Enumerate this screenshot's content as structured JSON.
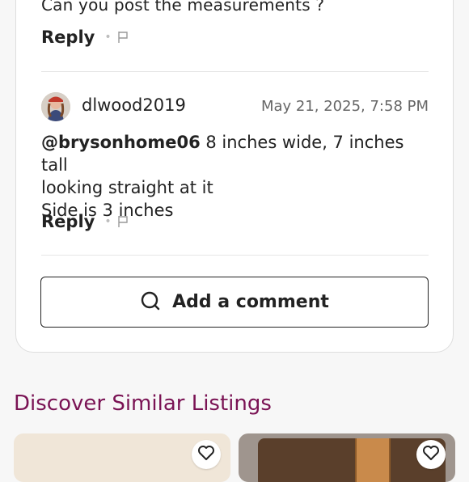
{
  "previous_comment": {
    "text": "Can you post the measurements ?",
    "reply_label": "Reply"
  },
  "comment": {
    "username": "dlwood2019",
    "timestamp": "May 21, 2025, 7:58 PM",
    "mention": "@brysonhome06",
    "body_line1": " 8 inches wide, 7 inches tall",
    "body_line2": "looking straight at it",
    "body_line3": "Side is 3 inches",
    "reply_label": "Reply"
  },
  "add_comment": {
    "label": "Add a comment",
    "icon": "search-icon"
  },
  "similar": {
    "title": "Discover Similar Listings",
    "listings": [
      {
        "icon": "heart-icon"
      },
      {
        "icon": "heart-icon"
      }
    ]
  },
  "colors": {
    "accent": "#7a1354",
    "text": "#222222",
    "border": "#dedede"
  }
}
